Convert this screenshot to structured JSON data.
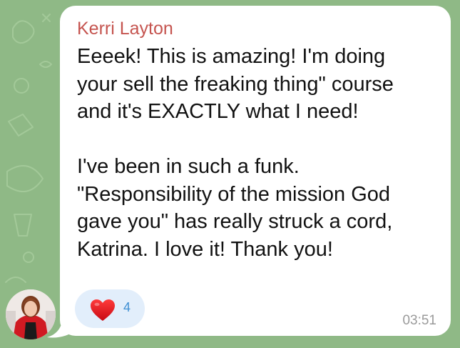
{
  "message": {
    "sender_name": "Kerri Layton",
    "paragraph1": [
      "Eeeek! This is amazing! I'm doing",
      "your sell the freaking thing\" course",
      "and it's EXACTLY what I need!"
    ],
    "paragraph2": [
      "I've been in such a funk.",
      "\"Responsibility of the mission God",
      "gave you\" has really struck a cord,",
      "Katrina.  I love it! Thank you!"
    ],
    "reaction": {
      "icon": "heart-icon",
      "count": "4"
    },
    "timestamp": "03:51"
  },
  "colors": {
    "background": "#8fb986",
    "bubble": "#ffffff",
    "sender_name": "#c5544f",
    "reaction_bg": "#e2eefb",
    "reaction_count": "#3f8fd3",
    "heart": "#e0141e",
    "timestamp": "#9a9a9a"
  }
}
